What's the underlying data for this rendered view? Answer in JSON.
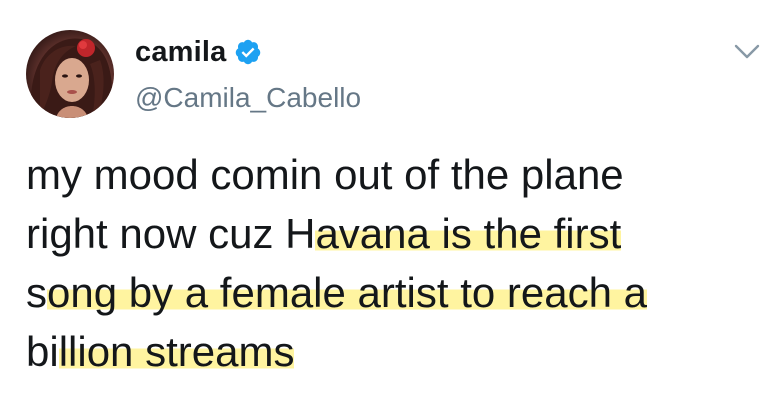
{
  "user": {
    "display_name": "camila",
    "handle": "@Camila_Cabello",
    "verified": true
  },
  "tweet": {
    "lines": [
      {
        "plain": "my mood comin out of the plane",
        "highlight": ""
      },
      {
        "plain": "right now cuz H",
        "highlight": "avana is the first"
      },
      {
        "plain": "s",
        "highlight": "ong by a female artist to reach a"
      },
      {
        "plain": "bi",
        "highlight": "llion streams"
      }
    ]
  },
  "colors": {
    "text": "#14171a",
    "secondary": "#657786",
    "verified_badge": "#1da1f2",
    "highlight": "#fff078"
  },
  "icons": {
    "verified": "verified-badge-icon",
    "more": "chevron-down-icon"
  }
}
